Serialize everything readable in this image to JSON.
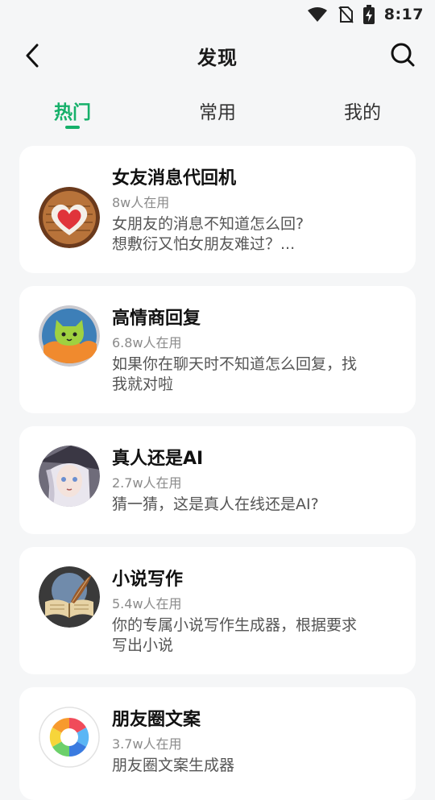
{
  "status_bar": {
    "time": "8:17",
    "icons": [
      "wifi-icon",
      "no-sim-icon",
      "battery-charging-icon"
    ]
  },
  "header": {
    "title": "发现",
    "back_icon": "chevron-left-icon",
    "search_icon": "search-icon"
  },
  "tabs": [
    {
      "label": "热门",
      "active": true
    },
    {
      "label": "常用",
      "active": false
    },
    {
      "label": "我的",
      "active": false
    }
  ],
  "accent_color": "#16b06a",
  "cards": [
    {
      "name": "女友消息代回机",
      "users": "8w人在用",
      "desc_lines": [
        "女朋友的消息不知道怎么回?",
        "想敷衍又怕女朋友难过？..."
      ],
      "avatar": "heart-badge-avatar"
    },
    {
      "name": "高情商回复",
      "users": "6.8w人在用",
      "desc_lines": [
        "如果你在聊天时不知道怎么回复，找",
        "我就对啦"
      ],
      "avatar": "cat-avatar"
    },
    {
      "name": "真人还是AI",
      "users": "2.7w人在用",
      "desc_lines": [
        "猜一猜，这是真人在线还是AI?"
      ],
      "avatar": "anime-girl-avatar"
    },
    {
      "name": "小说写作",
      "users": "5.4w人在用",
      "desc_lines": [
        "你的专属小说写作生成器，根据要求",
        "写出小说"
      ],
      "avatar": "book-quill-avatar"
    },
    {
      "name": "朋友圈文案",
      "users": "3.7w人在用",
      "desc_lines": [
        "朋友圈文案生成器"
      ],
      "avatar": "camera-aperture-avatar"
    }
  ]
}
